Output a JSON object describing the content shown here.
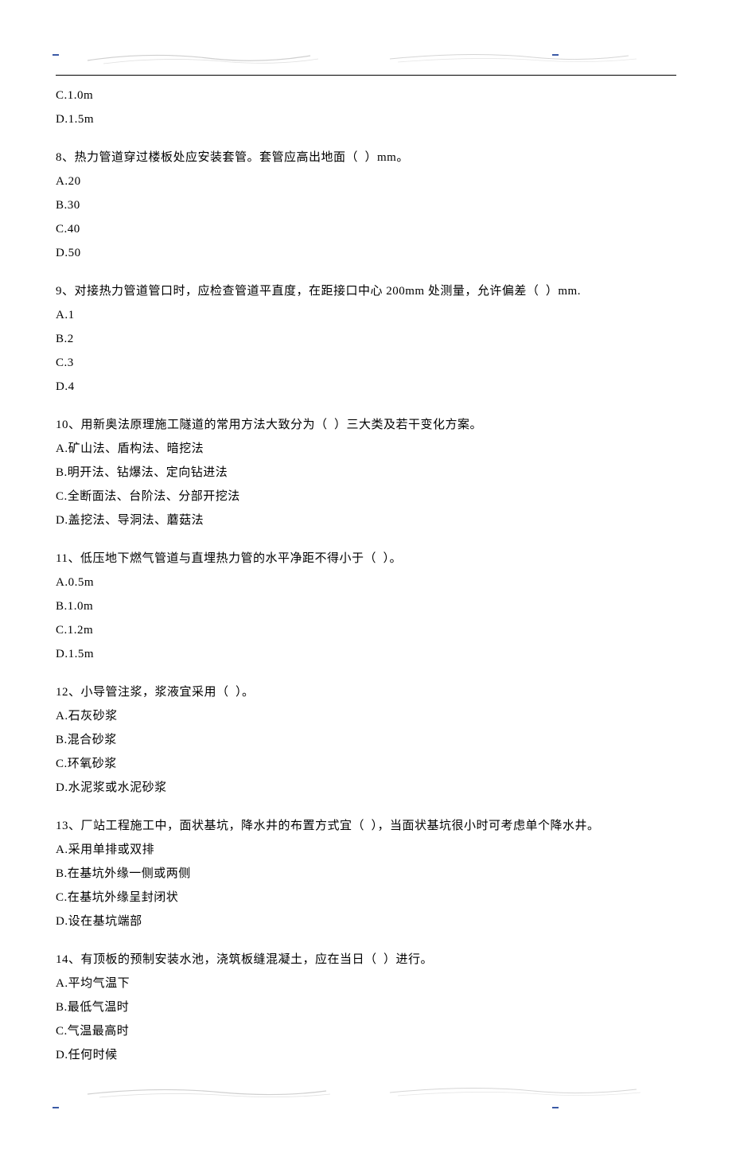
{
  "remainder_q7": {
    "options": [
      "C.1.0m",
      "D.1.5m"
    ]
  },
  "questions": [
    {
      "num": "8",
      "text": "热力管道穿过楼板处应安装套管。套管应高出地面（  ）mm。",
      "options": [
        "A.20",
        "B.30",
        "C.40",
        "D.50"
      ]
    },
    {
      "num": "9",
      "text": "对接热力管道管口时，应检查管道平直度，在距接口中心 200mm 处测量，允许偏差（  ）mm.",
      "options": [
        "A.1",
        "B.2",
        "C.3",
        "D.4"
      ]
    },
    {
      "num": "10",
      "text": "用新奥法原理施工隧道的常用方法大致分为（  ）三大类及若干变化方案。",
      "options": [
        "A.矿山法、盾构法、暗挖法",
        "B.明开法、钻爆法、定向钻进法",
        "C.全断面法、台阶法、分部开挖法",
        "D.盖挖法、导洞法、蘑菇法"
      ]
    },
    {
      "num": "11",
      "text": "低压地下燃气管道与直埋热力管的水平净距不得小于（  ）。",
      "options": [
        "A.0.5m",
        "B.1.0m",
        "C.1.2m",
        "D.1.5m"
      ]
    },
    {
      "num": "12",
      "text": "小导管注浆，浆液宜采用（  ）。",
      "options": [
        "A.石灰砂浆",
        "B.混合砂浆",
        "C.环氧砂浆",
        "D.水泥浆或水泥砂浆"
      ]
    },
    {
      "num": "13",
      "text": "厂站工程施工中，面状基坑，降水井的布置方式宜（  ），当面状基坑很小时可考虑单个降水井。",
      "options": [
        "A.采用单排或双排",
        "B.在基坑外缘一侧或两侧",
        "C.在基坑外缘呈封闭状",
        "D.设在基坑端部"
      ]
    },
    {
      "num": "14",
      "text": "有顶板的预制安装水池，浇筑板缝混凝土，应在当日（  ）进行。",
      "options": [
        "A.平均气温下",
        "B.最低气温时",
        "C.气温最高时",
        "D.任何时候"
      ]
    }
  ]
}
